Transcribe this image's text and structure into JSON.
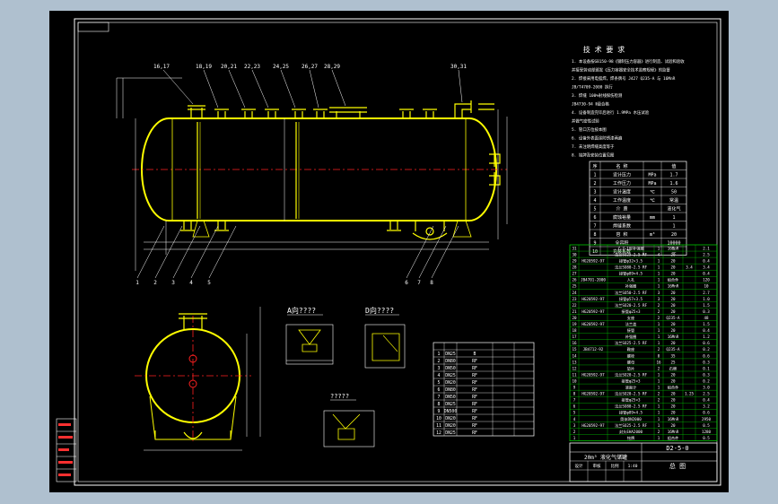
{
  "colors": {
    "background": "#afc0cf",
    "canvas": "#000000",
    "border": "#ffffff",
    "vessel": "#ffff00",
    "center_line": "#ff2020",
    "dimension": "#ffffff",
    "table_line": "#00c800"
  },
  "title_block": {
    "drawing_no": "D2-5-0",
    "sheet_label": "总 图"
  },
  "sections": {
    "view_a": "A向????",
    "view_d": "D向????",
    "detail": "?????"
  },
  "notes_header": "技 术 要 求",
  "notes": [
    "1. 本设备按GB150-98《钢制压力容器》进行制造、试验和验收",
    "   并接受劳动部颁发《压力容器安全技术监察规程》的监督",
    "2. 焊接采用电弧焊，焊条牌号 J427  Q235-A 与 16MnR",
    "   JB/T4709-2000 执行",
    "3. 焊缝 100%射线探伤检测",
    "   JB4730-94  Ⅱ级合格",
    "4. 设备制造完毕后进行 1.9MPa 水压试验",
    "   并做气密性试验",
    "5. 管口方位按本图",
    "6. 设备外表面涂防锈漆两遍",
    "7. 未注明焊缝高度等于",
    "8. 铭牌及安装位置见图"
  ],
  "spec_table": {
    "header": [
      "序",
      "名  称",
      "",
      "值"
    ],
    "rows": [
      [
        "1",
        "设计压力",
        "MPa",
        "1.7"
      ],
      [
        "2",
        "工作压力",
        "MPa",
        "1.6"
      ],
      [
        "3",
        "设计温度",
        "℃",
        "50"
      ],
      [
        "4",
        "工作温度",
        "℃",
        "常温"
      ],
      [
        "5",
        "介  质",
        "",
        "液化气"
      ],
      [
        "6",
        "腐蚀裕量",
        "mm",
        "1"
      ],
      [
        "7",
        "焊缝系数",
        "",
        "1"
      ],
      [
        "8",
        "容  积",
        "m³",
        "20"
      ],
      [
        "9",
        "全容积",
        "",
        "10000"
      ],
      [
        "10",
        "充装系数",
        "",
        "二"
      ]
    ]
  },
  "nozzle_table": {
    "header": [
      "",
      "",
      "",
      "",
      ""
    ],
    "rows": [
      [
        "1",
        "DN25",
        "B",
        "",
        ""
      ],
      [
        "2",
        "DN80",
        "RF",
        "",
        ""
      ],
      [
        "3",
        "DN50",
        "RF",
        "",
        ""
      ],
      [
        "4",
        "DN25",
        "RF",
        "",
        ""
      ],
      [
        "5",
        "DN20",
        "RF",
        "",
        ""
      ],
      [
        "6",
        "DN80",
        "RF",
        "",
        ""
      ],
      [
        "7",
        "DN50",
        "RF",
        "",
        ""
      ],
      [
        "8",
        "DN25",
        "RF",
        "",
        ""
      ],
      [
        "9",
        "DN500",
        "RF",
        "",
        ""
      ],
      [
        "10",
        "DN20",
        "RF",
        "",
        ""
      ],
      [
        "11",
        "DN20",
        "RF",
        "",
        ""
      ],
      [
        "12",
        "DN25",
        "RF",
        "",
        ""
      ]
    ]
  },
  "bom_rows": [
    [
      "31",
      "",
      "Z-Z-1型补强圈",
      "1",
      "16MnR",
      "",
      "2.1"
    ],
    [
      "30",
      "",
      "法兰SO25-2.5 RF",
      "4",
      "20",
      "",
      "2.5"
    ],
    [
      "29",
      "HG20592-97",
      "接管φ32×3.5",
      "1",
      "20",
      "",
      "0.4"
    ],
    [
      "28",
      "",
      "法兰SO80-2.5 RF",
      "1",
      "20",
      "3.4",
      "3.4"
    ],
    [
      "27",
      "",
      "接管φ89×4.5",
      "1",
      "20",
      "",
      "0.4"
    ],
    [
      "26",
      "JB4701-2000",
      "人孔",
      "1",
      "组合件",
      "",
      "120"
    ],
    [
      "25",
      "",
      "补强圈",
      "1",
      "16MnR",
      "",
      "10"
    ],
    [
      "24",
      "",
      "法兰SO50-2.5 RF",
      "3",
      "20",
      "",
      "2.7"
    ],
    [
      "23",
      "HG20592-97",
      "接管φ57×3.5",
      "3",
      "20",
      "",
      "1.0"
    ],
    [
      "22",
      "",
      "法兰SO20-2.5 RF",
      "2",
      "20",
      "",
      "1.5"
    ],
    [
      "21",
      "HG20592-97",
      "接管φ25×3",
      "2",
      "20",
      "",
      "0.3"
    ],
    [
      "20",
      "",
      "支座",
      "2",
      "Q235-A",
      "",
      "48"
    ],
    [
      "19",
      "HG20592-97",
      "法兰盖",
      "1",
      "20",
      "",
      "1.5"
    ],
    [
      "18",
      "",
      "接管",
      "1",
      "20",
      "",
      "0.4"
    ],
    [
      "17",
      "",
      "补强圈",
      "1",
      "16MnR",
      "",
      "1.2"
    ],
    [
      "16",
      "",
      "法兰SO25-2.5 RF",
      "1",
      "20",
      "",
      "0.6"
    ],
    [
      "15",
      "JB4712-92",
      "鞍座",
      "2",
      "Q235-A",
      "",
      "0.2"
    ],
    [
      "14",
      "",
      "螺栓",
      "8",
      "35",
      "",
      "0.6"
    ],
    [
      "13",
      "",
      "螺母",
      "16",
      "25",
      "",
      "0.3"
    ],
    [
      "12",
      "",
      "垫片",
      "2",
      "石棉",
      "",
      "0.1"
    ],
    [
      "11",
      "HG20592-97",
      "法兰SO20-2.5 RF",
      "1",
      "20",
      "",
      "0.3"
    ],
    [
      "10",
      "",
      "接管φ25×3",
      "1",
      "20",
      "",
      "0.2"
    ],
    [
      "9",
      "",
      "液面计",
      "1",
      "组合件",
      "",
      "3.0"
    ],
    [
      "8",
      "HG20592-97",
      "法兰SO20-2.5 RF",
      "2",
      "20",
      "1.25",
      "2.5"
    ],
    [
      "7",
      "",
      "接管φ25×3",
      "2",
      "20",
      "",
      "0.4"
    ],
    [
      "6",
      "",
      "法兰SO80-2.5 RF",
      "1",
      "20",
      "",
      "3.2"
    ],
    [
      "5",
      "",
      "接管φ89×4.5",
      "1",
      "20",
      "",
      "0.6"
    ],
    [
      "4",
      "",
      "筒体DN2000",
      "1",
      "16MnR",
      "",
      "2950"
    ],
    [
      "3",
      "HG20592-97",
      "法兰SO25-2.5 RF",
      "1",
      "20",
      "",
      "0.5"
    ],
    [
      "2",
      "",
      "封头EHA2000",
      "2",
      "16MnR",
      "",
      "1280"
    ],
    [
      "1",
      "",
      "铭牌",
      "1",
      "组合件",
      "",
      "0.5"
    ]
  ],
  "elevation_labels": [
    "16,17",
    "18,19",
    "20,21",
    "22,23",
    "24,25",
    "26,27",
    "28,29",
    "30,31"
  ],
  "leader_labels": [
    "1",
    "2",
    "3",
    "4",
    "5",
    "6",
    "7",
    "8",
    "9",
    "10"
  ],
  "title_fields": [
    "20m³ 液化气储罐",
    "设计",
    "审核",
    "比例",
    "1:40"
  ],
  "left_stamps": [
    "",
    "",
    "",
    "",
    ""
  ],
  "status": "D2-5-0"
}
